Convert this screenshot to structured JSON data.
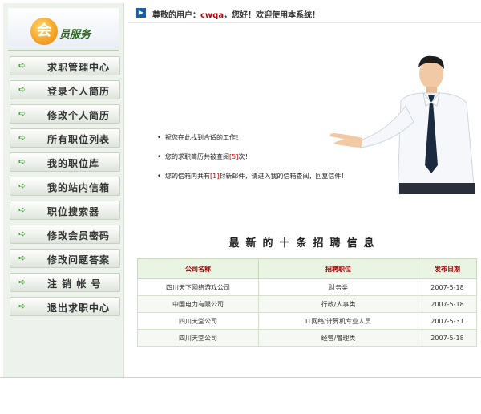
{
  "header": {
    "greeting_prefix": "尊敬的用户：",
    "username": "cwqa",
    "greeting_suffix": "，您好！欢迎使用本系统！"
  },
  "logo": {
    "badge": "会",
    "text": "员服务"
  },
  "sidebar": {
    "items": [
      {
        "label": "求职管理中心"
      },
      {
        "label": "登录个人简历"
      },
      {
        "label": "修改个人简历"
      },
      {
        "label": "所有职位列表"
      },
      {
        "label": "我的职位库"
      },
      {
        "label": "我的站内信箱"
      },
      {
        "label": "职位搜索器"
      },
      {
        "label": "修改会员密码"
      },
      {
        "label": "修改问题答案"
      },
      {
        "label": "注 销 帐 号"
      },
      {
        "label": "退出求职中心"
      }
    ]
  },
  "welcome": {
    "line1": "祝您在此找到合适的工作！",
    "line2_prefix": "您的求职简历共被查阅",
    "line2_count": "[5]",
    "line2_suffix": "次！",
    "line3_prefix": "您的信箱内共有",
    "line3_count": "[1]",
    "line3_suffix": "封新邮件，请进入我的信箱查阅，回复信件！"
  },
  "recent_jobs": {
    "title": "最新的十条招聘信息",
    "columns": [
      "公司名称",
      "招聘职位",
      "发布日期"
    ],
    "rows": [
      [
        "四川天下网络游戏公司",
        "财务类",
        "2007-5-18"
      ],
      [
        "中国电力有限公司",
        "行政/人事类",
        "2007-5-18"
      ],
      [
        "四川天堂公司",
        "IT网络/计算机专业人员",
        "2007-5-31"
      ],
      [
        "四川天堂公司",
        "经营/管理类",
        "2007-5-18"
      ]
    ]
  },
  "colors": {
    "accent": "#2d8a23",
    "highlight": "#d00000",
    "table_header_bg": "#eaf4e2"
  },
  "icons": [
    "arrow-right-icon",
    "triangle-right-icon"
  ]
}
